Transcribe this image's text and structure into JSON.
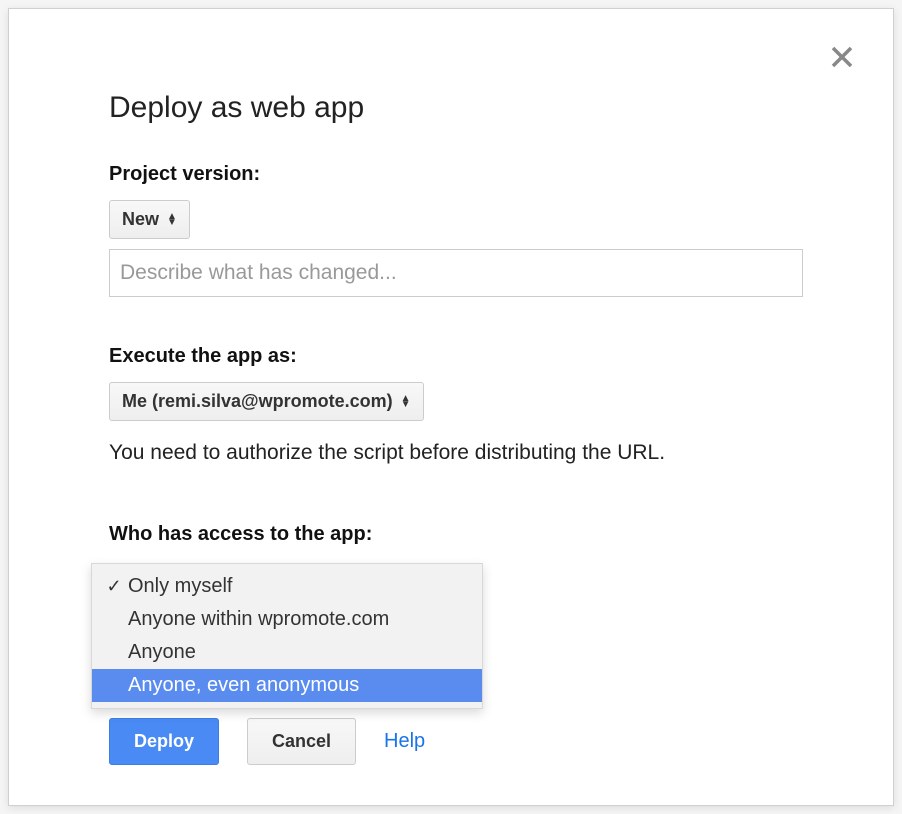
{
  "dialog": {
    "title": "Deploy as web app"
  },
  "version": {
    "label": "Project version:",
    "selected": "New",
    "describe_placeholder": "Describe what has changed..."
  },
  "execute": {
    "label": "Execute the app as:",
    "selected": "Me (remi.silva@wpromote.com)",
    "note": "You need to authorize the script before distributing the URL."
  },
  "access": {
    "label": "Who has access to the app:",
    "options": [
      {
        "label": "Only myself",
        "selected": true,
        "highlighted": false
      },
      {
        "label": "Anyone within wpromote.com",
        "selected": false,
        "highlighted": false
      },
      {
        "label": "Anyone",
        "selected": false,
        "highlighted": false
      },
      {
        "label": "Anyone, even anonymous",
        "selected": false,
        "highlighted": true
      }
    ]
  },
  "buttons": {
    "deploy": "Deploy",
    "cancel": "Cancel",
    "help": "Help"
  }
}
